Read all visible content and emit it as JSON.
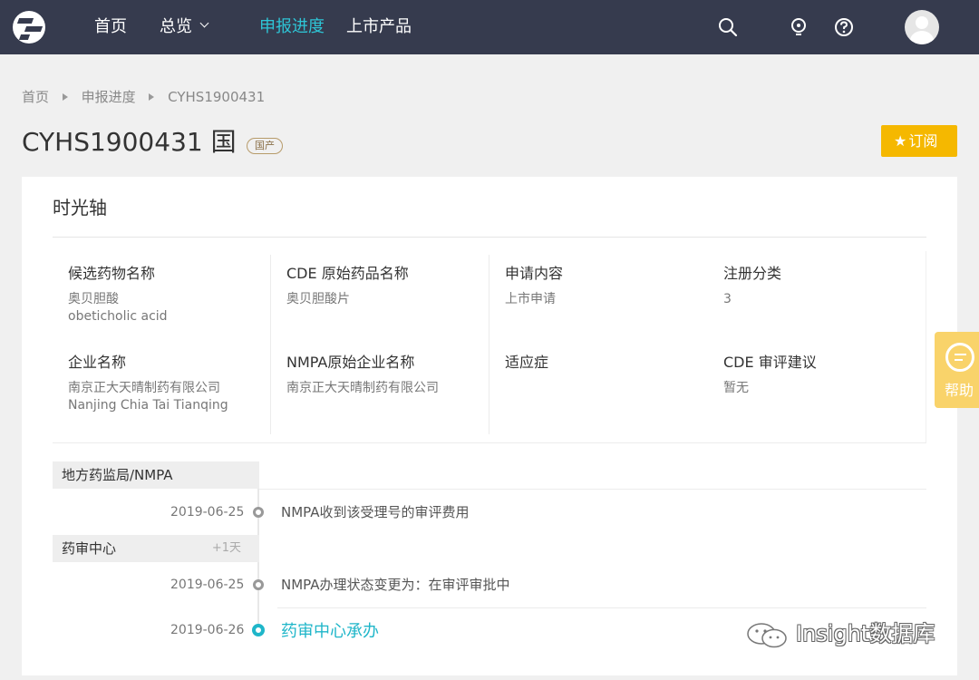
{
  "nav": {
    "items": [
      {
        "label": "首页"
      },
      {
        "label": "总览"
      },
      {
        "label": "申报进度"
      },
      {
        "label": "上市产品"
      }
    ]
  },
  "breadcrumb": {
    "items": [
      "首页",
      "申报进度",
      "CYHS1900431"
    ]
  },
  "header": {
    "title": "CYHS1900431 国",
    "badge": "国产",
    "subscribe_label": "订阅"
  },
  "card": {
    "title": "时光轴",
    "info": [
      {
        "label": "候选药物名称",
        "value": "奥贝胆酸",
        "value2": "obeticholic acid"
      },
      {
        "label": "CDE 原始药品名称",
        "value": "奥贝胆酸片",
        "value2": ""
      },
      {
        "label": "申请内容",
        "value": "上市申请",
        "value2": ""
      },
      {
        "label": "注册分类",
        "value": "3",
        "value2": ""
      },
      {
        "label": "企业名称",
        "value": "南京正大天晴制药有限公司",
        "value2": "Nanjing Chia Tai Tianqing"
      },
      {
        "label": "NMPA原始企业名称",
        "value": "南京正大天晴制药有限公司",
        "value2": ""
      },
      {
        "label": "适应症",
        "value": "",
        "value2": ""
      },
      {
        "label": "CDE 审评建议",
        "value": "暂无",
        "value2": ""
      }
    ]
  },
  "timeline": {
    "groups": [
      {
        "label": "地方药监局/NMPA",
        "meta": ""
      },
      {
        "label": "药审中心",
        "meta": "+1天"
      }
    ],
    "events": [
      {
        "date": "2019-06-25",
        "text": "NMPA收到该受理号的审评费用",
        "current": false
      },
      {
        "date": "2019-06-25",
        "text": "NMPA办理状态变更为：在审评审批中",
        "current": false
      },
      {
        "date": "2019-06-26",
        "text": "药审中心承办",
        "current": true
      }
    ]
  },
  "help": {
    "label": "帮助"
  },
  "watermark": {
    "text": "Insight数据库"
  },
  "colors": {
    "nav_bg": "#363b4e",
    "nav_active": "#2ec5d6",
    "accent": "#1fb6c9",
    "subscribe_bg": "#f5b800",
    "help_bg": "#f9d36a"
  }
}
